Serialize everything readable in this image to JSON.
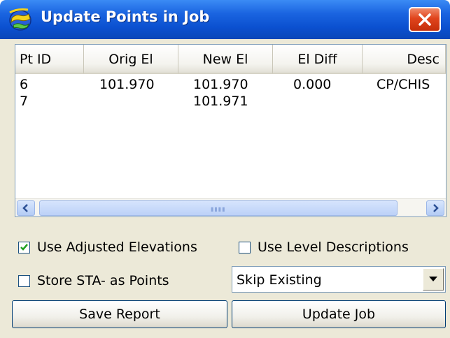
{
  "window": {
    "title": "Update Points in Job"
  },
  "icons": {
    "app": "globe-icon",
    "close": "close-icon"
  },
  "table": {
    "columns": [
      "Pt ID",
      "Orig El",
      "New El",
      "El Diff",
      "Desc"
    ],
    "rows": [
      [
        "6",
        "101.970",
        "101.970",
        "0.000",
        "CP/CHIS"
      ],
      [
        "7",
        "",
        "101.971",
        "",
        ""
      ]
    ]
  },
  "options": {
    "use_adjusted_elevations": {
      "label": "Use Adjusted Elevations",
      "checked": true
    },
    "use_level_descriptions": {
      "label": "Use Level Descriptions",
      "checked": false
    },
    "store_sta_as_points": {
      "label": "Store STA- as Points",
      "checked": false
    }
  },
  "existing_mode": {
    "value": "Skip Existing"
  },
  "buttons": {
    "save_report": "Save Report",
    "update_job": "Update Job"
  },
  "colors": {
    "title_bar": "#0b50d0",
    "close_button": "#e0441c",
    "dialog_bg": "#ece9d8"
  }
}
